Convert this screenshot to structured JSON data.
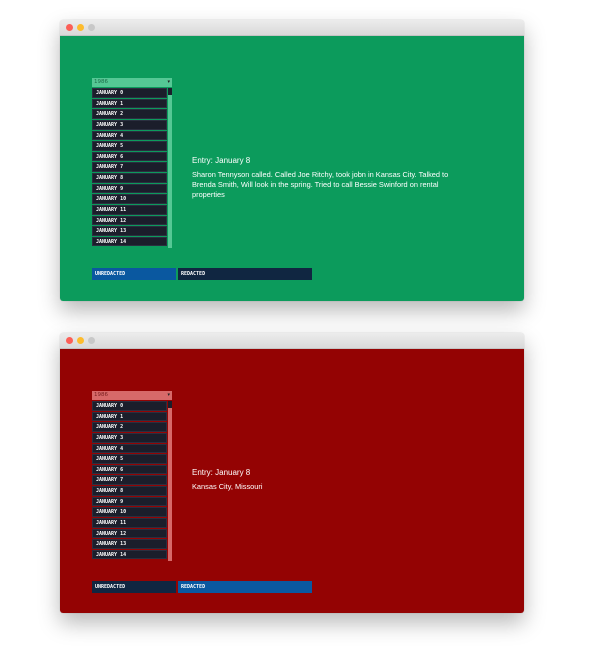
{
  "windows": [
    {
      "year": "1986",
      "dates": [
        "JANUARY 0",
        "JANUARY 1",
        "JANUARY 2",
        "JANUARY 3",
        "JANUARY 4",
        "JANUARY 5",
        "JANUARY 6",
        "JANUARY 7",
        "JANUARY 8",
        "JANUARY 9",
        "JANUARY 10",
        "JANUARY 11",
        "JANUARY 12",
        "JANUARY 13",
        "JANUARY 14"
      ],
      "entry_title": "Entry: January 8",
      "entry_body": "Sharon Tennyson called. Called Joe Ritchy, took jobn in Kansas City. Talked to Brenda Smith, Will look in the spring. Tried to call Bessie Swinford on rental properties",
      "unredacted_label": "UNREDACTED",
      "redacted_label": "REDACTED",
      "active_tab": "unredacted"
    },
    {
      "year": "1986",
      "dates": [
        "JANUARY 0",
        "JANUARY 1",
        "JANUARY 2",
        "JANUARY 3",
        "JANUARY 4",
        "JANUARY 5",
        "JANUARY 6",
        "JANUARY 7",
        "JANUARY 8",
        "JANUARY 9",
        "JANUARY 10",
        "JANUARY 11",
        "JANUARY 12",
        "JANUARY 13",
        "JANUARY 14"
      ],
      "entry_title": "Entry: January 8",
      "entry_body": "Kansas City, Missouri",
      "unredacted_label": "UNREDACTED",
      "redacted_label": "REDACTED",
      "active_tab": "redacted"
    }
  ]
}
